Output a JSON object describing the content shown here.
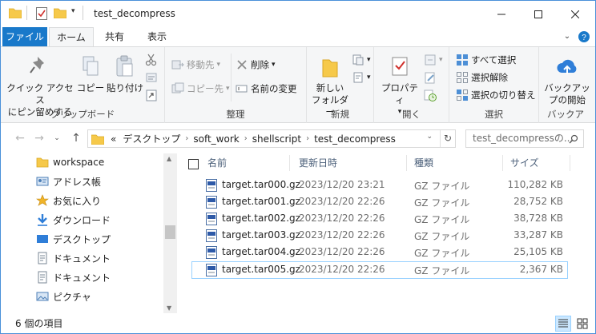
{
  "window": {
    "title": "test_decompress"
  },
  "tabs": [
    {
      "label": "ファイル"
    },
    {
      "label": "ホーム"
    },
    {
      "label": "共有"
    },
    {
      "label": "表示"
    }
  ],
  "ribbon": {
    "clipboard": {
      "label": "クリップボード",
      "pin_line1": "クイック アクセス",
      "pin_line2": "にピン留めする",
      "copy": "コピー",
      "paste": "貼り付け"
    },
    "organize": {
      "label": "整理",
      "move_to": "移動先",
      "copy_to": "コピー先",
      "delete": "削除",
      "rename": "名前の変更"
    },
    "new": {
      "label": "新規",
      "folder_line1": "新しい",
      "folder_line2": "フォルダー"
    },
    "open": {
      "label": "開く",
      "properties": "プロパティ"
    },
    "select": {
      "label": "選択",
      "select_all": "すべて選択",
      "select_none": "選択解除",
      "invert": "選択の切り替え"
    },
    "backup": {
      "label": "バックア",
      "btn_line1": "バックアッ",
      "btn_line2": "プの開始"
    }
  },
  "address": {
    "overflow": "«",
    "crumbs": [
      "デスクトップ",
      "soft_work",
      "shellscript",
      "test_decompress"
    ],
    "search_placeholder": "test_decompressの..."
  },
  "nav": {
    "items": [
      {
        "label": "workspace",
        "icon": "folder-icon"
      },
      {
        "label": "アドレス帳",
        "icon": "contacts-icon"
      },
      {
        "label": "お気に入り",
        "icon": "favorites-icon"
      },
      {
        "label": "ダウンロード",
        "icon": "download-icon"
      },
      {
        "label": "デスクトップ",
        "icon": "desktop-icon"
      },
      {
        "label": "ドキュメント",
        "icon": "document-icon"
      },
      {
        "label": "ドキュメント",
        "icon": "document-icon"
      },
      {
        "label": "ピクチャ",
        "icon": "pictures-icon"
      }
    ]
  },
  "columns": {
    "name": "名前",
    "modified": "更新日時",
    "type": "種類",
    "size": "サイズ"
  },
  "files": [
    {
      "name": "target.tar000.gz",
      "modified": "2023/12/20 23:21",
      "type": "GZ ファイル",
      "size": "110,282 KB"
    },
    {
      "name": "target.tar001.gz",
      "modified": "2023/12/20 22:26",
      "type": "GZ ファイル",
      "size": "28,752 KB"
    },
    {
      "name": "target.tar002.gz",
      "modified": "2023/12/20 22:26",
      "type": "GZ ファイル",
      "size": "38,728 KB"
    },
    {
      "name": "target.tar003.gz",
      "modified": "2023/12/20 22:26",
      "type": "GZ ファイル",
      "size": "33,287 KB"
    },
    {
      "name": "target.tar004.gz",
      "modified": "2023/12/20 22:26",
      "type": "GZ ファイル",
      "size": "25,105 KB"
    },
    {
      "name": "target.tar005.gz",
      "modified": "2023/12/20 22:26",
      "type": "GZ ファイル",
      "size": "2,367 KB"
    }
  ],
  "status": {
    "count": "6 個の項目"
  },
  "colors": {
    "accent": "#1979ca",
    "selection_border": "#99d1ff",
    "folder": "#f6c94a"
  }
}
